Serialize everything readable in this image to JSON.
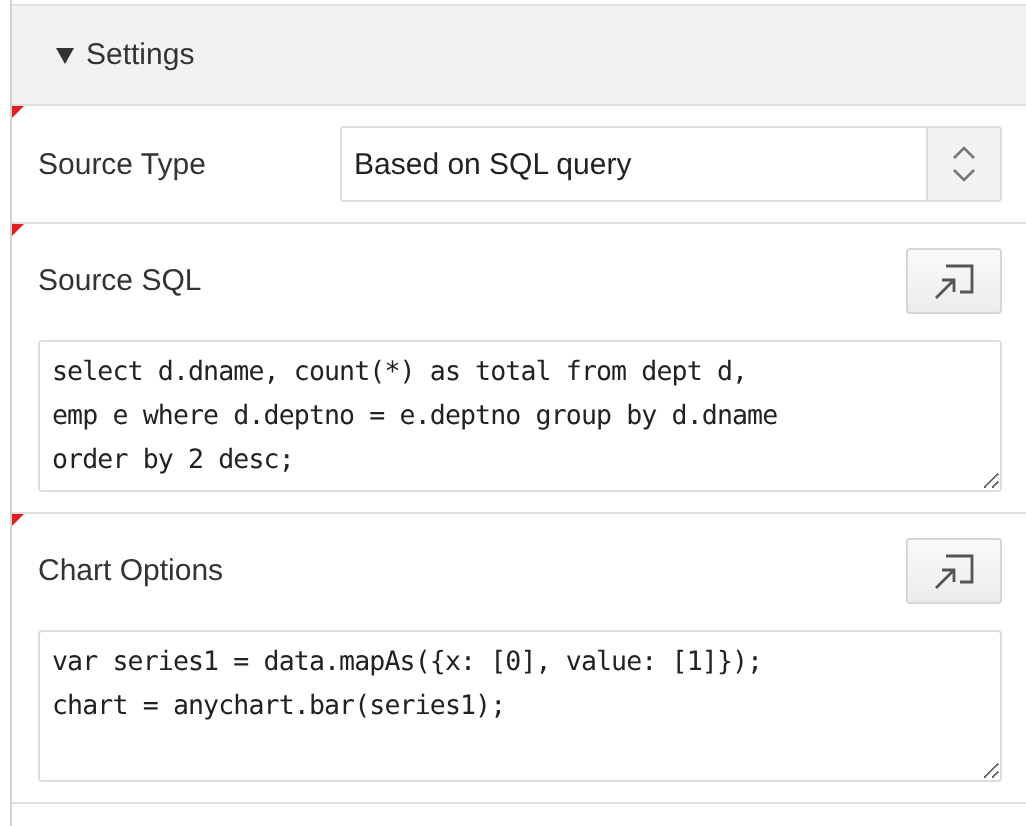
{
  "section": {
    "title": "Settings",
    "expanded": true,
    "fields": [
      {
        "kind": "select",
        "label": "Source Type",
        "value": "Based on SQL query",
        "required": true
      },
      {
        "kind": "code",
        "label": "Source SQL",
        "value": "select d.dname, count(*) as total from dept d,\nemp e where d.deptno = e.deptno group by d.dname\norder by 2 desc;",
        "required": true
      },
      {
        "kind": "code",
        "label": "Chart Options",
        "value": "var series1 = data.mapAs({x: [0], value: [1]});\nchart = anychart.bar(series1);",
        "required": true
      }
    ]
  }
}
